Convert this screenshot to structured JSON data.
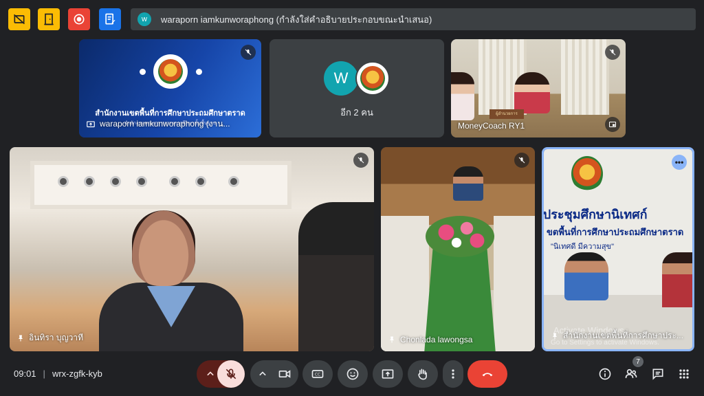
{
  "top_bar": {
    "buttons": [
      {
        "name": "captions-off-icon",
        "color": "#fbbc04"
      },
      {
        "name": "door-icon",
        "color": "#fbbc04"
      },
      {
        "name": "record-icon",
        "color": "#ea4335"
      },
      {
        "name": "notes-icon",
        "color": "#1a73e8"
      }
    ],
    "presenter_initial": "w",
    "presenter_text": "waraporn iamkunworaphong (กำลังใส่คำอธิบายประกอบขณะนำเสนอ)"
  },
  "tiles": {
    "slide": {
      "label": "waraporn iamkunworaphong (งาน...",
      "title": "สำนักงานเขตพื้นที่การศึกษาประถมศึกษาตราด",
      "subtitle": "สำนักงานคณะกรรมการการศึกษาขั้นพื้นฐาน"
    },
    "others": {
      "avatar_initial": "W",
      "label": "อีก 2 คน"
    },
    "moneycoach": {
      "label": "MoneyCoach RY1",
      "nameplate": "ผู้อำนวยการ"
    },
    "woman": {
      "label": "อินทิรา บุญวาที"
    },
    "chonlada": {
      "label": "Chonlada lawongsa"
    },
    "office": {
      "label": "สำนักงานเขตพื้นที่การศึกษาประ...",
      "poster_line1": "งประชุมศึกษานิเทศก์",
      "poster_line2": "ขตพื้นที่การศึกษาประถมศึกษาตราด",
      "poster_line3": "\"นิเทศดี มีความสุข\"",
      "watermark_title": "Activate Windows",
      "watermark_sub": "Go to Settings to activate Windows."
    }
  },
  "bottom_bar": {
    "time": "09:01",
    "meeting_code": "wrx-zgfk-kyb",
    "people_count": "7"
  },
  "colors": {
    "background": "#202124",
    "tile": "#3c4043",
    "end_call": "#ea4335",
    "mic_muted_pill": "#f9dedc"
  }
}
